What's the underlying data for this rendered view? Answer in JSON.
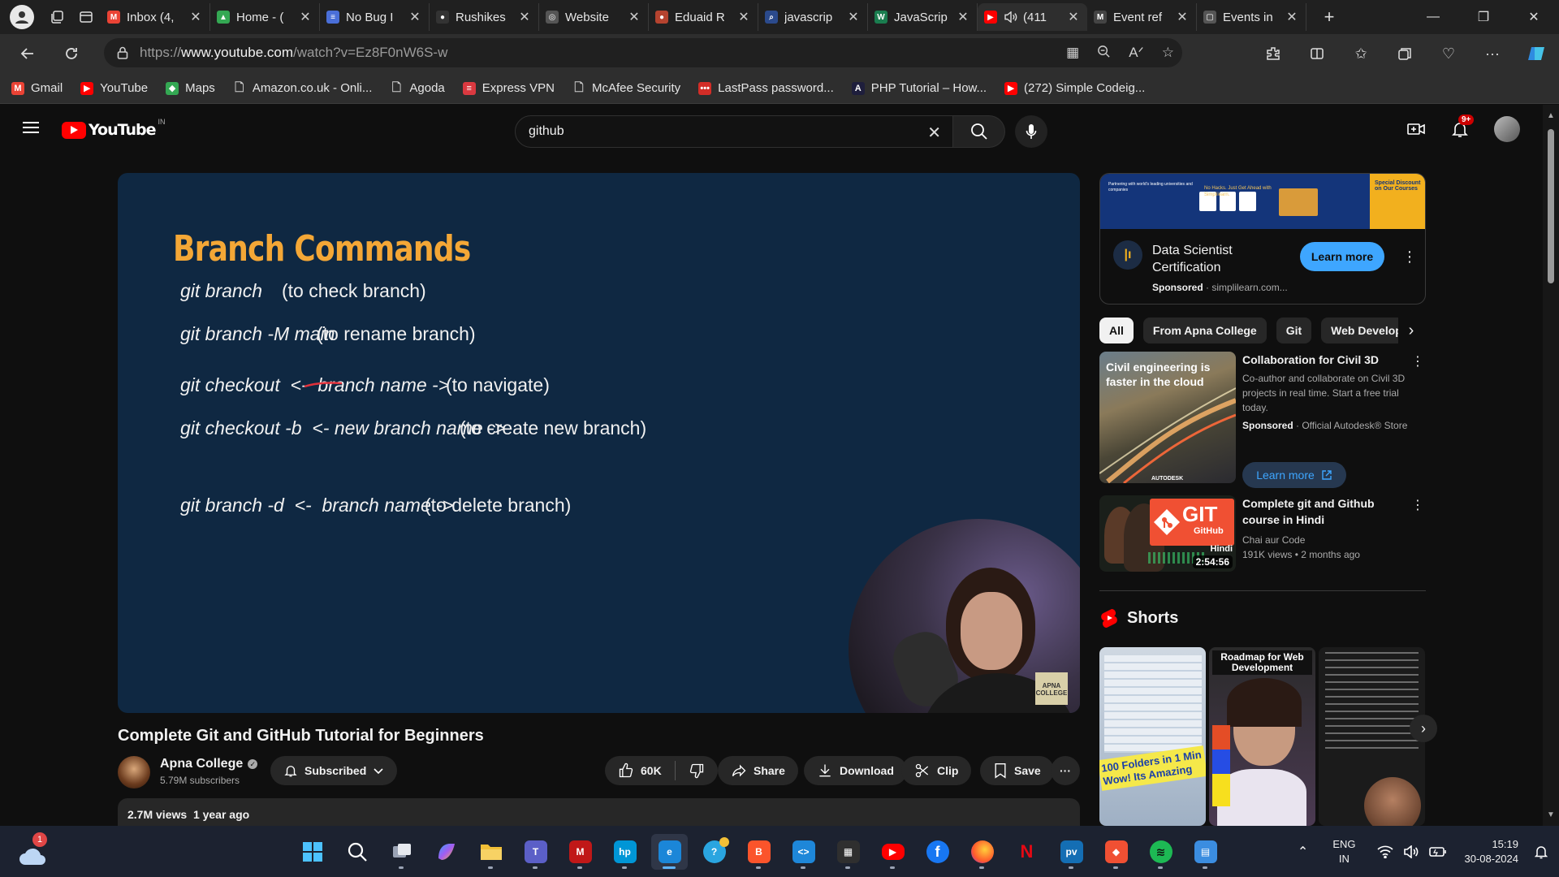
{
  "browser": {
    "tabs": [
      {
        "label": "Inbox (4,",
        "fav": "M",
        "color": "#ea4335"
      },
      {
        "label": "Home - (",
        "fav": "▲",
        "color": "#34a853"
      },
      {
        "label": "No Bug I",
        "fav": "≡",
        "color": "#4a6fd8"
      },
      {
        "label": "Rushikes",
        "fav": "●",
        "color": "#333333"
      },
      {
        "label": "Website",
        "fav": "◎",
        "color": "#555555"
      },
      {
        "label": "Eduaid R",
        "fav": "●",
        "color": "#b5432f"
      },
      {
        "label": "javascrip",
        "fav": "⌕",
        "color": "#2b4a8c"
      },
      {
        "label": "JavaScrip",
        "fav": "W",
        "color": "#1a7d4f"
      },
      {
        "label": "(411",
        "fav": "▶",
        "color": "#ff0000",
        "active": true
      },
      {
        "label": "Event ref",
        "fav": "M",
        "color": "#444444"
      },
      {
        "label": "Events in",
        "fav": "▢",
        "color": "#555555"
      }
    ],
    "url_prefix": "https://",
    "url_domain": "www.youtube.com",
    "url_path": "/watch?v=Ez8F0nW6S-w",
    "bookmarks": [
      {
        "label": "Gmail",
        "icon": "M",
        "color": "#ea4335"
      },
      {
        "label": "YouTube",
        "icon": "▶",
        "color": "#ff0000"
      },
      {
        "label": "Maps",
        "icon": "◆",
        "color": "#34a853"
      },
      {
        "label": "Amazon.co.uk - Onli...",
        "icon": "▢",
        "color": "#888888"
      },
      {
        "label": "Agoda",
        "icon": "▢",
        "color": "#888888"
      },
      {
        "label": "Express VPN",
        "icon": "≡",
        "color": "#da3940"
      },
      {
        "label": "McAfee Security",
        "icon": "▢",
        "color": "#888888"
      },
      {
        "label": "LastPass password...",
        "icon": "•••",
        "color": "#d32d27"
      },
      {
        "label": "PHP Tutorial – How...",
        "icon": "A",
        "color": "#1e1e3c"
      },
      {
        "label": "(272) Simple Codeig...",
        "icon": "▶",
        "color": "#ff0000"
      }
    ]
  },
  "youtube": {
    "logo_text": "YouTube",
    "country": "IN",
    "search_value": "github",
    "notifications": "9+",
    "video": {
      "slide_title": "Branch Commands",
      "commands": [
        {
          "cmd": "git branch",
          "desc": "(to check branch)"
        },
        {
          "cmd": "git branch -M main",
          "desc": "(to rename branch)"
        },
        {
          "cmd": "git checkout  <-  branch name ->",
          "desc": "(to navigate)"
        },
        {
          "cmd": "git checkout -b  <- new branch name ->",
          "desc": "(to create new branch)"
        },
        {
          "cmd": "git branch -d  <-  branch name ->",
          "desc": "(to delete branch)"
        }
      ],
      "watermark": "APNA COLLEGE",
      "title": "Complete Git and GitHub Tutorial for Beginners",
      "channel": "Apna College",
      "subscribers": "5.79M subscribers",
      "subscribe_label": "Subscribed",
      "likes": "60K",
      "share_label": "Share",
      "download_label": "Download",
      "clip_label": "Clip",
      "save_label": "Save",
      "views": "2.7M views",
      "age": "1 year ago"
    },
    "ad": {
      "title": "Data Scientist Certification",
      "sponsored": "Sponsored",
      "domain": "simplilearn.com...",
      "cta": "Learn more",
      "banner_a": "Partnering with world's leading universities and companies",
      "banner_b": "No Hacks. Just Get Ahead with Simplilearn.",
      "banner_gold": "Special Discount on Our Courses"
    },
    "chips": [
      "All",
      "From Apna College",
      "Git",
      "Web Developm"
    ],
    "recs": [
      {
        "title": "Collaboration for Civil 3D",
        "desc": "Co-author and collaborate on Civil 3D projects in real time. Start a free trial today.",
        "sponsored": "Sponsored",
        "advertiser": "Official Autodesk® Store",
        "cta": "Learn more",
        "thumb_text": "Civil engineering is faster in the cloud",
        "thumb_brand": "AUTODESK"
      },
      {
        "title": "Complete git and Github course in Hindi",
        "channel": "Chai aur Code",
        "views": "191K views",
        "age": "2 months ago",
        "duration": "2:54:56",
        "thumb_git": "GIT",
        "thumb_github": "GitHub",
        "thumb_lang": "Hindi"
      }
    ],
    "shorts_title": "Shorts",
    "shorts": [
      {
        "text": "100 Folders in 1 Min Wow! Its Amazing"
      },
      {
        "text": "Roadmap for Web Development"
      },
      {
        "text": ""
      }
    ]
  },
  "taskbar": {
    "weather_badge": "1",
    "apps": [
      {
        "name": "windows-start",
        "color": "#3aa0ff",
        "label": ""
      },
      {
        "name": "search",
        "color": "transparent",
        "label": ""
      },
      {
        "name": "task-view",
        "color": "transparent",
        "label": ""
      },
      {
        "name": "copilot",
        "color": "#6b5bd6",
        "label": ""
      },
      {
        "name": "file-explorer",
        "color": "#f2c037",
        "label": ""
      },
      {
        "name": "teams",
        "color": "#5b5fc7",
        "label": "T"
      },
      {
        "name": "mcafee",
        "color": "#c01818",
        "label": "M"
      },
      {
        "name": "myhp",
        "color": "#0096d6",
        "label": "hp"
      },
      {
        "name": "edge",
        "color": "#1b86d8",
        "label": "e",
        "active": true
      },
      {
        "name": "help",
        "color": "#2aa5e0",
        "label": "?"
      },
      {
        "name": "brave",
        "color": "#fb542b",
        "label": "B"
      },
      {
        "name": "vscode",
        "color": "#1e87d9",
        "label": "<>"
      },
      {
        "name": "store",
        "color": "#2f2f2f",
        "label": "▦"
      },
      {
        "name": "youtube",
        "color": "#ff0000",
        "label": "▶"
      },
      {
        "name": "facebook",
        "color": "#1877f2",
        "label": "f"
      },
      {
        "name": "firefox",
        "color": "#ff7139",
        "label": "ff"
      },
      {
        "name": "netflix",
        "color": "#1c2230",
        "label": "N"
      },
      {
        "name": "prime-video",
        "color": "#146eb4",
        "label": "pv"
      },
      {
        "name": "git-gui",
        "color": "#f05033",
        "label": "◆"
      },
      {
        "name": "spotify",
        "color": "#1db954",
        "label": "≋"
      },
      {
        "name": "notepad",
        "color": "#3b8de0",
        "label": "▤"
      }
    ],
    "lang_line1": "ENG",
    "lang_line2": "IN",
    "time": "15:19",
    "date": "30-08-2024"
  }
}
